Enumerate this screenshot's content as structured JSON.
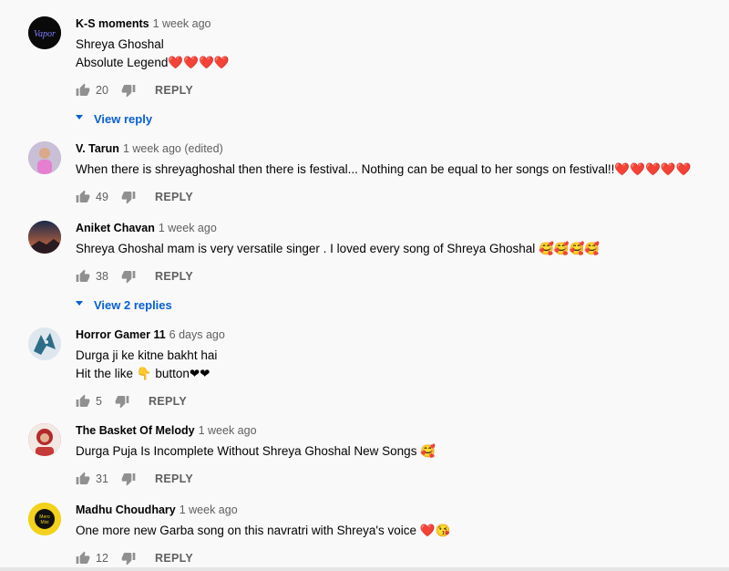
{
  "comments": [
    {
      "author": "K-S moments",
      "time": "1 week ago",
      "lines": [
        "Shreya Ghoshal",
        "Absolute Legend❤️❤️❤️❤️"
      ],
      "likes": "20",
      "reply_label": "REPLY",
      "view_replies": "View reply",
      "avatar_color": "#0a0a0a"
    },
    {
      "author": "V. Tarun",
      "time": "1 week ago (edited)",
      "lines": [
        "When there is shreyaghoshal then there is festival... Nothing can be equal to her songs on festival!!❤️❤️❤️❤️❤️"
      ],
      "likes": "49",
      "reply_label": "REPLY",
      "avatar_color": "#b5a4c8"
    },
    {
      "author": "Aniket Chavan",
      "time": "1 week ago",
      "lines": [
        "Shreya Ghoshal mam is very versatile singer . I loved every song of Shreya Ghoshal 🥰🥰🥰🥰"
      ],
      "likes": "38",
      "reply_label": "REPLY",
      "view_replies": "View 2 replies",
      "avatar_color": "#1f2a44"
    },
    {
      "author": "Horror Gamer 11",
      "time": "6 days ago",
      "lines": [
        "Durga ji ke kitne bakht hai",
        "Hit the like 👇 button❤❤"
      ],
      "likes": "5",
      "reply_label": "REPLY",
      "avatar_color": "#dfe7ee"
    },
    {
      "author": "The Basket Of Melody",
      "time": "1 week ago",
      "lines": [
        "Durga Puja Is Incomplete Without Shreya Ghoshal New Songs 🥰"
      ],
      "likes": "31",
      "reply_label": "REPLY",
      "avatar_color": "#c63a3a"
    },
    {
      "author": "Madhu Choudhary",
      "time": "1 week ago",
      "lines": [
        "One more new Garba song on this navratri with Shreya's voice ❤️😘"
      ],
      "likes": "12",
      "reply_label": "REPLY",
      "avatar_color": "#f2d21b"
    }
  ],
  "colors": {
    "background": "#f9f9f9",
    "link_blue": "#065fd4",
    "meta_gray": "#606060"
  },
  "icons": {
    "like": "thumb-up-icon",
    "dislike": "thumb-down-icon",
    "expand": "caret-down-icon"
  }
}
